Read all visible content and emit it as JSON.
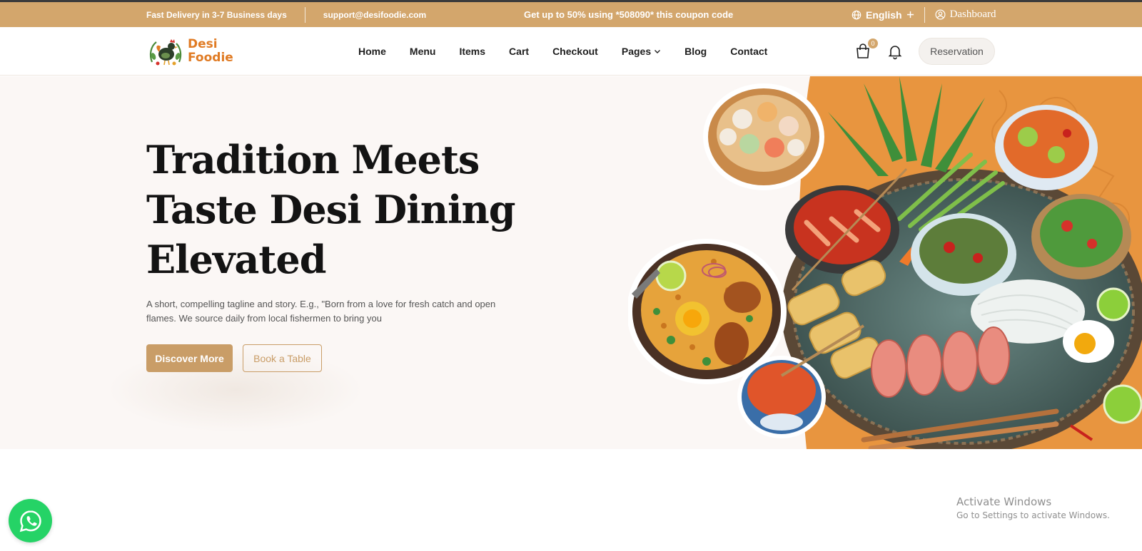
{
  "topbar": {
    "delivery": "Fast Delivery in 3-7 Business days",
    "email": "support@desifoodie.com",
    "promo": "Get up to 50% using *508090* this coupon code",
    "language": "English",
    "dashboard": "Dashboard",
    "colors": {
      "background": "#d3a66c",
      "text": "#ffffff"
    }
  },
  "brand": {
    "line1": "Desi",
    "line2": "Foodie",
    "color": "#e07b24"
  },
  "nav": {
    "items": [
      {
        "label": "Home"
      },
      {
        "label": "Menu"
      },
      {
        "label": "Items"
      },
      {
        "label": "Cart"
      },
      {
        "label": "Checkout"
      },
      {
        "label": "Pages",
        "dropdown": true
      },
      {
        "label": "Blog"
      },
      {
        "label": "Contact"
      }
    ],
    "cart_count": "0",
    "reservation": "Reservation"
  },
  "hero": {
    "title_lines": [
      "Tradition Meets",
      "Taste Desi Dining",
      "Elevated"
    ],
    "tagline": "A short, compelling tagline and story. E.g., \"Born from a love for fresh catch and open flames. We source daily from local fishermen to bring you",
    "primary_button": "Discover More",
    "secondary_button": "Book a Table",
    "colors": {
      "accent": "#c99d67",
      "art_background": "#e8953f"
    }
  },
  "system": {
    "activate_title": "Activate Windows",
    "activate_sub": "Go to Settings to activate Windows."
  },
  "icons": [
    "globe-icon",
    "plus-icon",
    "user-circle-icon",
    "cart-icon",
    "bell-icon",
    "chevron-down-icon",
    "whatsapp-icon"
  ]
}
